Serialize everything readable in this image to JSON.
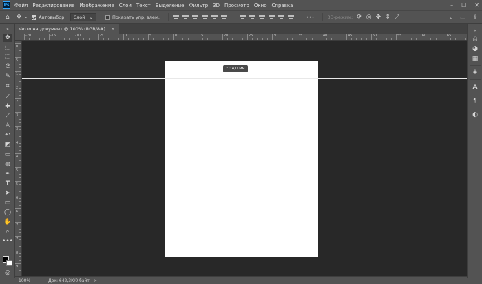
{
  "menubar": {
    "app_logo": "Ps",
    "items": [
      "Файл",
      "Редактирование",
      "Изображение",
      "Слои",
      "Текст",
      "Выделение",
      "Фильтр",
      "3D",
      "Просмотр",
      "Окно",
      "Справка"
    ]
  },
  "options": {
    "autoselect_label": "Автовыбор:",
    "autoselect_checked": true,
    "target_value": "Слой",
    "show_controls_label": "Показать упр. элем.",
    "show_controls_checked": false,
    "mode_3d_label": "3D-режим:",
    "more_label": "•••"
  },
  "document": {
    "tab_title": "Фото на документ @ 100% (RGB/8#)",
    "tooltip": "Y : 4,0 мм",
    "background": "#ffffff"
  },
  "rulers": {
    "horizontal_labels": [
      "-20",
      "-15",
      "-10",
      "-5",
      "0",
      "5",
      "10",
      "15",
      "20",
      "25",
      "30",
      "35",
      "40",
      "45",
      "50",
      "55",
      "60",
      "65"
    ],
    "vertical_labels": [
      "0",
      "5",
      "1",
      "2",
      "2",
      "3",
      "3",
      "4",
      "4",
      "5",
      "5",
      "6",
      "6",
      "7",
      "7",
      "8",
      "9"
    ]
  },
  "status": {
    "zoom": "100%",
    "doc_info": "Док: 642,3К/0 байт",
    "arrow": ">"
  },
  "colors": {
    "ui_bg": "#535353",
    "canvas_bg": "#282828",
    "guide": "#e8e8e8",
    "foreground": "#000000",
    "background": "#ffffff"
  },
  "icons": {
    "toolbar_left": [
      "move-icon",
      "artboard-icon",
      "marquee-icon",
      "lasso-icon",
      "quick-select-icon",
      "crop-icon",
      "eyedropper-icon",
      "healing-brush-icon",
      "brush-icon",
      "clone-stamp-icon",
      "history-brush-icon",
      "eraser-icon",
      "gradient-icon",
      "blur-icon",
      "dodge-icon",
      "pen-icon",
      "type-icon",
      "path-select-icon",
      "rectangle-icon",
      "hand-icon",
      "zoom-icon",
      "more-tools-icon"
    ],
    "panel_right": [
      "history-icon",
      "color-icon",
      "swatches-icon",
      "grid-icon",
      "layers-icon",
      "character-icon",
      "paragraph-icon",
      "adjustments-icon"
    ]
  }
}
